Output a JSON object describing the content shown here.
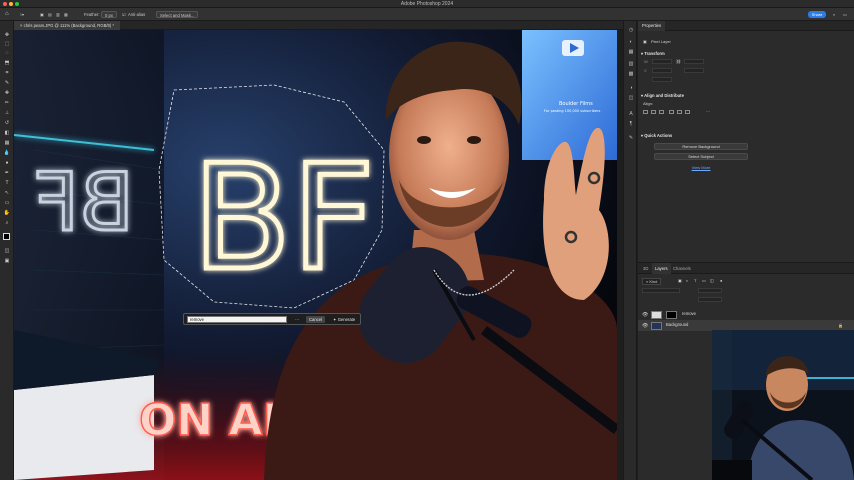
{
  "window": {
    "title": "Adobe Photoshop 2024"
  },
  "options_bar": {
    "feather_label": "Feather:",
    "feather_value": "0 px",
    "antialias_label": "Anti-alias",
    "select_mask_button": "Select and Mask...",
    "share_button": "Share"
  },
  "document": {
    "tab_title": "chris pears.JPG @ 111% (Background, RGB/8) *"
  },
  "canvas": {
    "sign_text": "BF",
    "sign_text_mirrored": "BF",
    "onair_text": "ON AIR",
    "youtube_text_1": "Boulder Films",
    "youtube_text_2": "For posting 100,000 subscribers"
  },
  "generative_bar": {
    "prompt_value": "remove",
    "more_icon": "more-icon",
    "cancel_label": "Cancel",
    "generate_label": "Generate"
  },
  "properties": {
    "tab": "Properties",
    "layer_type": "Pixel Layer",
    "transform_header": "Transform",
    "align_header": "Align and Distribute",
    "align_label": "Align:",
    "quick_actions_header": "Quick Actions",
    "remove_bg_button": "Remove Background",
    "select_subject_button": "Select Subject",
    "view_more_link": "View More"
  },
  "layers": {
    "tabs": [
      "3D",
      "Layers",
      "Channels"
    ],
    "active_tab": "Layers",
    "kind_filter": "Kind",
    "items": [
      {
        "name": "remove"
      },
      {
        "name": "Background"
      }
    ]
  },
  "colors": {
    "accent": "#2d7be5",
    "neon": "#fff7d6",
    "onair": "#ff5a4a"
  }
}
